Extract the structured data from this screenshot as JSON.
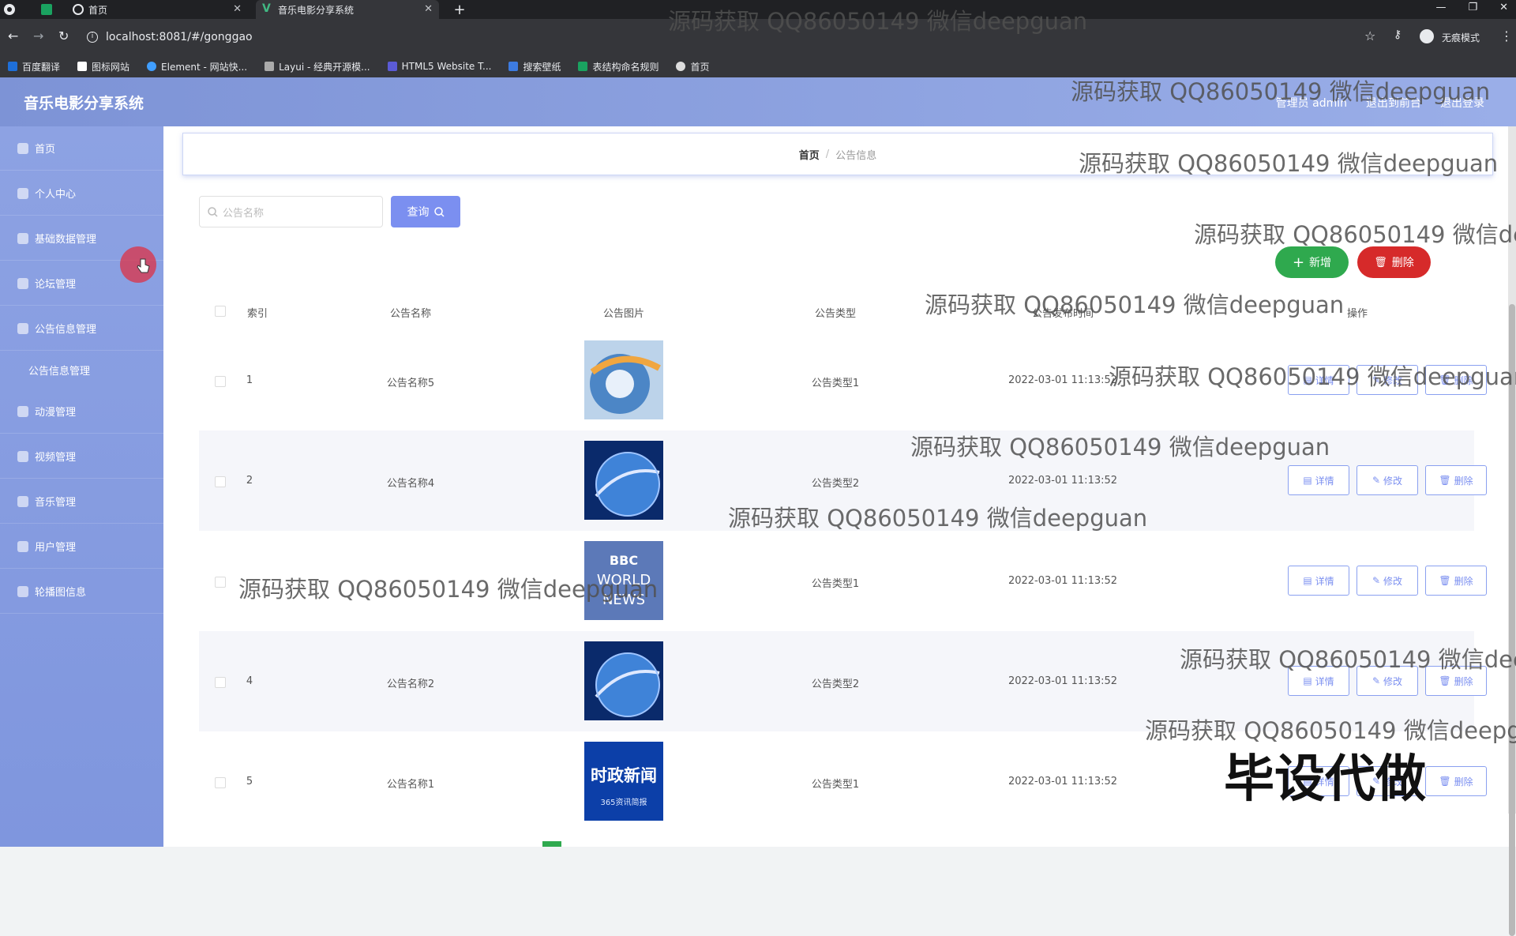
{
  "browser": {
    "tabs": [
      {
        "title": "首页"
      },
      {
        "title": "音乐电影分享系统"
      }
    ],
    "url": "localhost:8081/#/gonggao",
    "incognito_label": "无痕模式",
    "bookmarks": [
      {
        "label": "百度翻译",
        "color": "#1e6fd9"
      },
      {
        "label": "图标网站",
        "color": "#ffffff"
      },
      {
        "label": "Element - 网站快...",
        "color": "#409eff"
      },
      {
        "label": "Layui - 经典开源模...",
        "color": "#aaaaaa"
      },
      {
        "label": "HTML5 Website T...",
        "color": "#5b5bd6"
      },
      {
        "label": "搜索壁纸",
        "color": "#3d7be0"
      },
      {
        "label": "表结构命名规则",
        "color": "#1aa260"
      },
      {
        "label": "首页",
        "color": "#dddddd"
      }
    ]
  },
  "header": {
    "brand": "音乐电影分享系统",
    "nav": [
      "管理员 admin",
      "退出到前台",
      "退出登录"
    ]
  },
  "sidebar": {
    "items": [
      {
        "label": "首页"
      },
      {
        "label": "个人中心"
      },
      {
        "label": "基础数据管理"
      },
      {
        "label": "论坛管理"
      },
      {
        "label": "公告信息管理"
      },
      {
        "label": "公告信息管理"
      },
      {
        "label": "动漫管理"
      },
      {
        "label": "视频管理"
      },
      {
        "label": "音乐管理"
      },
      {
        "label": "用户管理"
      },
      {
        "label": "轮播图信息"
      }
    ]
  },
  "breadcrumb": {
    "home": "首页",
    "separator": "/",
    "current": "公告信息"
  },
  "search": {
    "placeholder": "公告名称",
    "button": "查询"
  },
  "actions": {
    "add": "新增",
    "delete": "删除"
  },
  "table": {
    "headers": [
      "索引",
      "公告名称",
      "公告图片",
      "公告类型",
      "公告发布时间",
      "操作"
    ],
    "rows": [
      {
        "index": "1",
        "name": "公告名称5",
        "type": "公告类型1",
        "time": "2022-03-01 11:13:52",
        "image": "globe-light"
      },
      {
        "index": "2",
        "name": "公告名称4",
        "type": "公告类型2",
        "time": "2022-03-01 11:13:52",
        "image": "globe-dark"
      },
      {
        "index": "",
        "name": "",
        "type": "公告类型1",
        "time": "2022-03-01 11:13:52",
        "image": "bbc-world-news"
      },
      {
        "index": "4",
        "name": "公告名称2",
        "type": "公告类型2",
        "time": "2022-03-01 11:13:52",
        "image": "globe-dark"
      },
      {
        "index": "5",
        "name": "公告名称1",
        "type": "公告类型1",
        "time": "2022-03-01 11:13:52",
        "image": "shizheng-news"
      }
    ],
    "ops": {
      "detail": "详情",
      "edit": "修改",
      "delete": "删除"
    }
  },
  "images": {
    "bbc": [
      "BBC",
      "WORLD",
      "NEWS"
    ],
    "shizheng": [
      "时政新闻",
      "365资讯简报"
    ]
  },
  "watermarks": {
    "text": "源码获取 QQ86050149 微信deepguan",
    "big": "毕设代做"
  },
  "colors": {
    "primary": "#7b8ff0",
    "success": "#2fa94e",
    "danger": "#d62a2a",
    "sidebar": "#8da2e3"
  }
}
